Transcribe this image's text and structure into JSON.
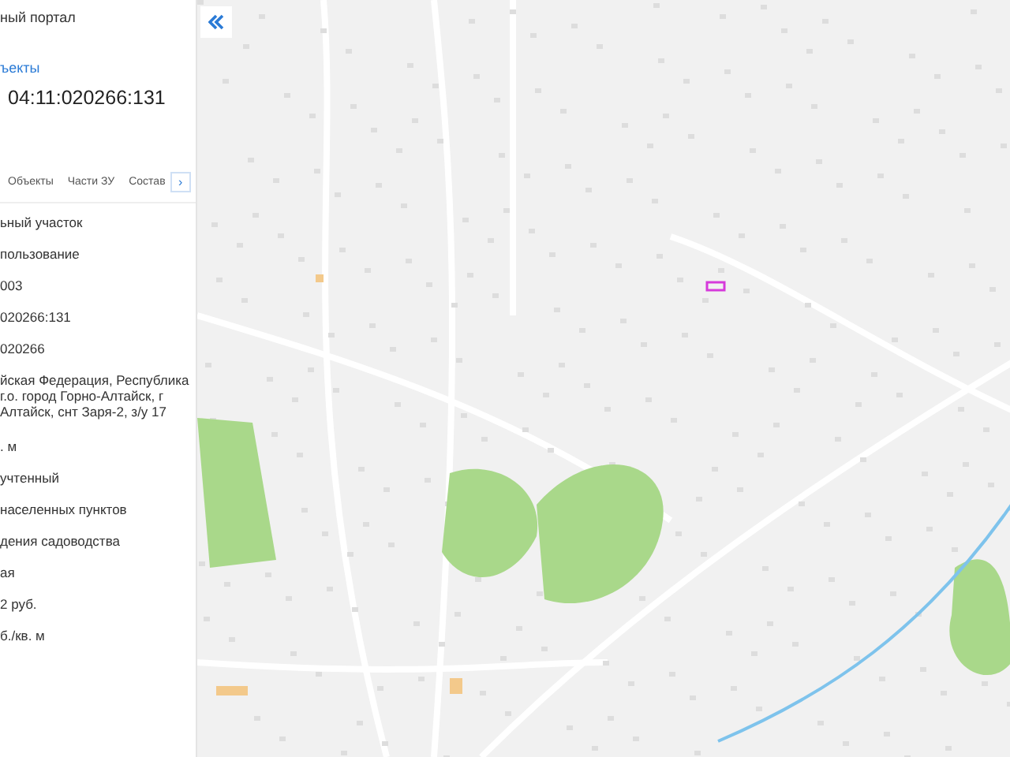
{
  "header": {
    "title": "ный портал",
    "link": "ъекты",
    "cadastral_number": "04:11:020266:131"
  },
  "tabs": [
    {
      "label": "Объекты",
      "selected": false
    },
    {
      "label": "Части ЗУ",
      "selected": false
    },
    {
      "label": "Состав",
      "selected": false
    }
  ],
  "tabs_next": "›",
  "rows": [
    "ьный участок",
    "пользование",
    "003",
    "020266:131",
    "020266",
    "йская Федерация, Республика\nг.о. город Горно-Алтайск, г\nАлтайск, снт Заря-2, з/у 17",
    ". м",
    "учтенный",
    "населенных пунктов",
    "дения садоводства",
    "ая",
    "2 руб.",
    "б./кв. м"
  ]
}
